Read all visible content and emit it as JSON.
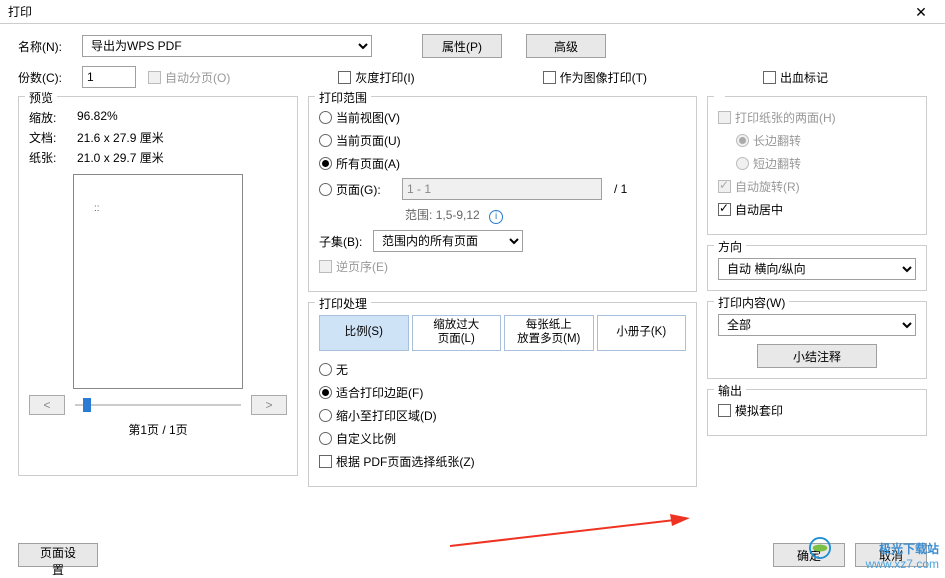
{
  "title": "打印",
  "printer": {
    "name_label": "名称(N):",
    "name_value": "导出为WPS PDF",
    "props_btn": "属性(P)",
    "advanced_btn": "高级",
    "copies_label": "份数(C):",
    "copies_value": "1",
    "collate_label": "自动分页(O)",
    "grayscale_label": "灰度打印(I)",
    "as_image_label": "作为图像打印(T)",
    "bleed_label": "出血标记"
  },
  "preview": {
    "title": "预览",
    "scale_label": "缩放:",
    "scale_value": "96.82%",
    "doc_label": "文档:",
    "doc_value": "21.6 x 27.9 厘米",
    "paper_label": "纸张:",
    "paper_value": "21.0 x 29.7 厘米",
    "thumbnail_text": "::",
    "prev": "<",
    "next": ">",
    "page_indicator": "第1页 / 1页"
  },
  "range": {
    "title": "打印范围",
    "current_view": "当前视图(V)",
    "current_page": "当前页面(U)",
    "all_pages": "所有页面(A)",
    "pages_label": "页面(G):",
    "pages_value": "1 - 1",
    "pages_total": "/ 1",
    "example_label": "范围:",
    "example_value": "1,5-9,12",
    "subset_label": "子集(B):",
    "subset_value": "范围内的所有页面",
    "reverse_label": "逆页序(E)"
  },
  "handling": {
    "title": "打印处理",
    "tabs": [
      "比例(S)",
      "缩放过大\n页面(L)",
      "每张纸上\n放置多页(M)",
      "小册子(K)"
    ],
    "none": "无",
    "fit_margin": "适合打印边距(F)",
    "shrink": "缩小至打印区域(D)",
    "custom": "自定义比例",
    "choose_paper": "根据 PDF页面选择纸张(Z)"
  },
  "duplex": {
    "both_sides": "打印纸张的两面(H)",
    "flip_long": "长边翻转",
    "flip_short": "短边翻转",
    "auto_rotate": "自动旋转(R)",
    "auto_center": "自动居中"
  },
  "orientation": {
    "title": "方向",
    "value": "自动 横向/纵向"
  },
  "print_content": {
    "title": "打印内容(W)",
    "value": "全部",
    "summary_btn": "小结注释"
  },
  "output": {
    "title": "输出",
    "simulate_label": "模拟套印"
  },
  "footer": {
    "page_setup": "页面设置",
    "ok": "确定",
    "cancel": "取消"
  },
  "watermark": {
    "brand": "极光下载站",
    "url": "www.xz7.com"
  }
}
